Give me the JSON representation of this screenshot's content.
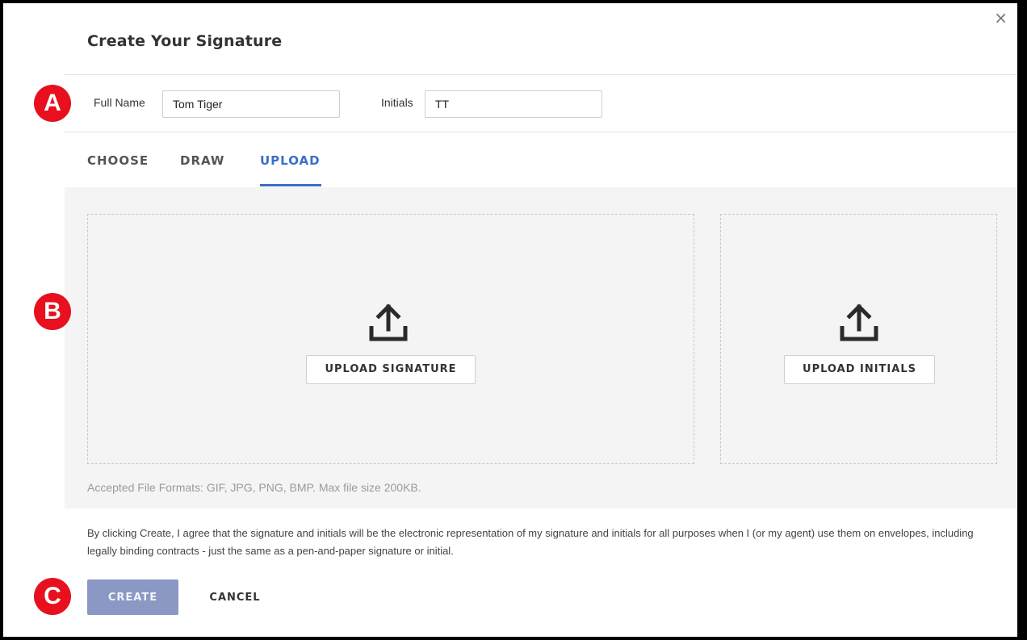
{
  "dialog": {
    "title": "Create Your Signature",
    "close_glyph": "×"
  },
  "name_fields": {
    "full_name_label": "Full Name",
    "full_name_value": "Tom Tiger",
    "initials_label": "Initials",
    "initials_value": "TT"
  },
  "tabs": [
    {
      "label": "CHOOSE",
      "active": false
    },
    {
      "label": "DRAW",
      "active": false
    },
    {
      "label": "UPLOAD",
      "active": true
    }
  ],
  "upload": {
    "signature_button": "UPLOAD SIGNATURE",
    "initials_button": "UPLOAD INITIALS",
    "icon": "upload-icon",
    "formats_note": "Accepted File Formats: GIF, JPG, PNG, BMP. Max file size 200KB."
  },
  "consent_text": "By clicking Create, I agree that the signature and initials will be the electronic representation of my signature and initials for all purposes when I (or my agent) use them on envelopes, including legally binding contracts - just the same as a pen-and-paper signature or initial.",
  "actions": {
    "create_label": "CREATE",
    "cancel_label": "CANCEL"
  },
  "markers": [
    "A",
    "B",
    "C"
  ],
  "colors": {
    "accent": "#3a6fc9",
    "create_button": "#8b98c4",
    "marker": "#e8101e",
    "upload_area_bg": "#f4f4f4"
  }
}
